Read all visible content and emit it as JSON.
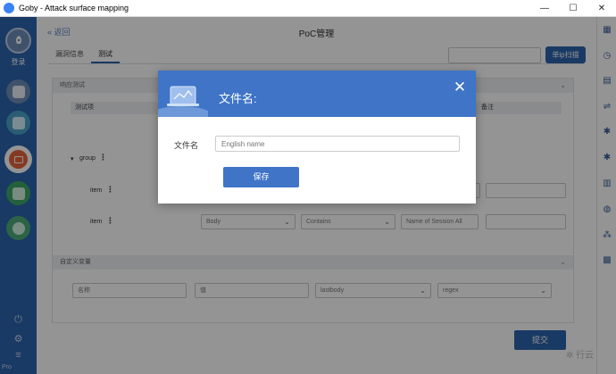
{
  "window": {
    "title": "Goby - Attack surface mapping",
    "minimize": "—",
    "maximize": "☐",
    "close": "✕"
  },
  "sidebar": {
    "login_label": "登录",
    "version": "Pro"
  },
  "main": {
    "back": "« 返回",
    "page_title": "PoC管理",
    "tabs": [
      {
        "label": "漏洞信息"
      },
      {
        "label": "测试"
      }
    ],
    "scan_button": "单ip扫描",
    "section_response": "响应测试",
    "col_test_item": "测试项",
    "col_note": "备注",
    "group_label": "group",
    "item_label": "item",
    "row2": {
      "field1": "Body",
      "field2": "Contains",
      "field3": "Name of Session All"
    },
    "section_custom_vars": "自定义变量",
    "custom_vars": {
      "name": "名称",
      "value": "值",
      "type": "lastbody",
      "mode": "regex"
    },
    "submit": "提交",
    "watermark": "✲ 行云"
  },
  "modal": {
    "title": "文件名:",
    "close": "✕",
    "field_label": "文件名",
    "field_placeholder": "English name",
    "save": "保存"
  },
  "colors": {
    "sidebar": "#2b64ad",
    "modal_header": "#3f74c7",
    "primary_button": "#2b64ad"
  }
}
